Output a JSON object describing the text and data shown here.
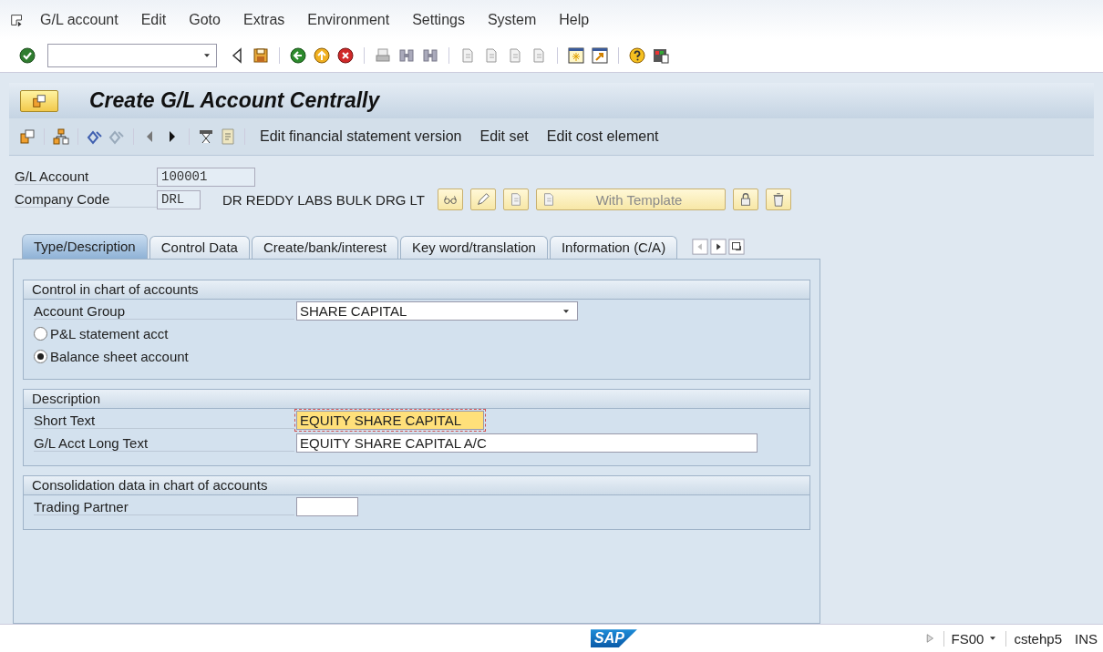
{
  "menu_bar": {
    "items": [
      "G/L account",
      "Edit",
      "Goto",
      "Extras",
      "Environment",
      "Settings",
      "System",
      "Help"
    ]
  },
  "title": "Create G/L Account Centrally",
  "app_toolbar": {
    "buttons": [
      "Edit financial statement version",
      "Edit set",
      "Edit cost element"
    ]
  },
  "header": {
    "gl_account": {
      "label": "G/L Account",
      "value": "100001"
    },
    "company_code": {
      "label": "Company Code",
      "value": "DRL",
      "name": "DR REDDY LABS BULK DRG LT"
    },
    "template_button": {
      "label": "With Template",
      "disabled": true
    }
  },
  "tabs": [
    {
      "label": "Type/Description",
      "selected": true
    },
    {
      "label": "Control Data",
      "selected": false
    },
    {
      "label": "Create/bank/interest",
      "selected": false
    },
    {
      "label": "Key word/translation",
      "selected": false
    },
    {
      "label": "Information (C/A)",
      "selected": false
    }
  ],
  "groups": [
    {
      "title": "Control in chart of accounts",
      "rows": [
        {
          "kind": "dropdown",
          "label": "Account Group",
          "value": "SHARE CAPITAL"
        },
        {
          "kind": "radio",
          "label": "P&L statement acct",
          "selected": false
        },
        {
          "kind": "radio",
          "label": "Balance sheet account",
          "selected": true
        }
      ]
    },
    {
      "title": "Description",
      "rows": [
        {
          "kind": "text",
          "label": "Short Text",
          "value": "EQUITY SHARE CAPITAL",
          "focused": true
        },
        {
          "kind": "text",
          "label": "G/L Acct Long Text",
          "value": "EQUITY SHARE CAPITAL A/C",
          "focused": false
        }
      ]
    },
    {
      "title": "Consolidation data in chart of accounts",
      "rows": [
        {
          "kind": "text",
          "label": "Trading Partner",
          "focused": false
        }
      ]
    }
  ],
  "status_bar": {
    "logo": "SAP",
    "transaction": "FS00",
    "server": "cstehp5",
    "mode": "INS"
  }
}
